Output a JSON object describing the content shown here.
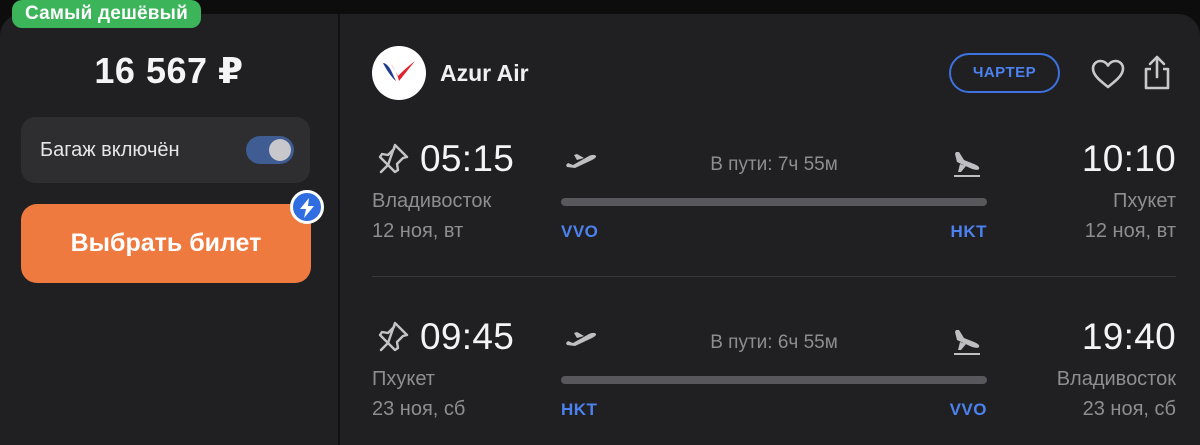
{
  "badge": {
    "label": "Самый дешёвый"
  },
  "price": {
    "value": "16 567 ₽"
  },
  "baggage": {
    "label": "Багаж включён",
    "enabled": true
  },
  "buy_button": {
    "label": "Выбрать билет"
  },
  "airline": {
    "name": "Azur Air",
    "tag": "ЧАРТЕР"
  },
  "actions": {
    "favorite_icon": "heart-icon",
    "share_icon": "share-icon"
  },
  "legs": [
    {
      "departure": {
        "time": "05:15",
        "city": "Владивосток",
        "date": "12 ноя, вт",
        "code": "VVO"
      },
      "arrival": {
        "time": "10:10",
        "city": "Пхукет",
        "date": "12 ноя, вт",
        "code": "HKT"
      },
      "duration": "В пути: 7ч 55м"
    },
    {
      "departure": {
        "time": "09:45",
        "city": "Пхукет",
        "date": "23 ноя, сб",
        "code": "HKT"
      },
      "arrival": {
        "time": "19:40",
        "city": "Владивосток",
        "date": "23 ноя, сб",
        "code": "VVO"
      },
      "duration": "В пути: 6ч 55м"
    }
  ],
  "colors": {
    "accent_blue": "#4b82f0",
    "badge_green": "#3bb45a",
    "button_orange": "#ef7a3f",
    "card_background": "#202022"
  }
}
